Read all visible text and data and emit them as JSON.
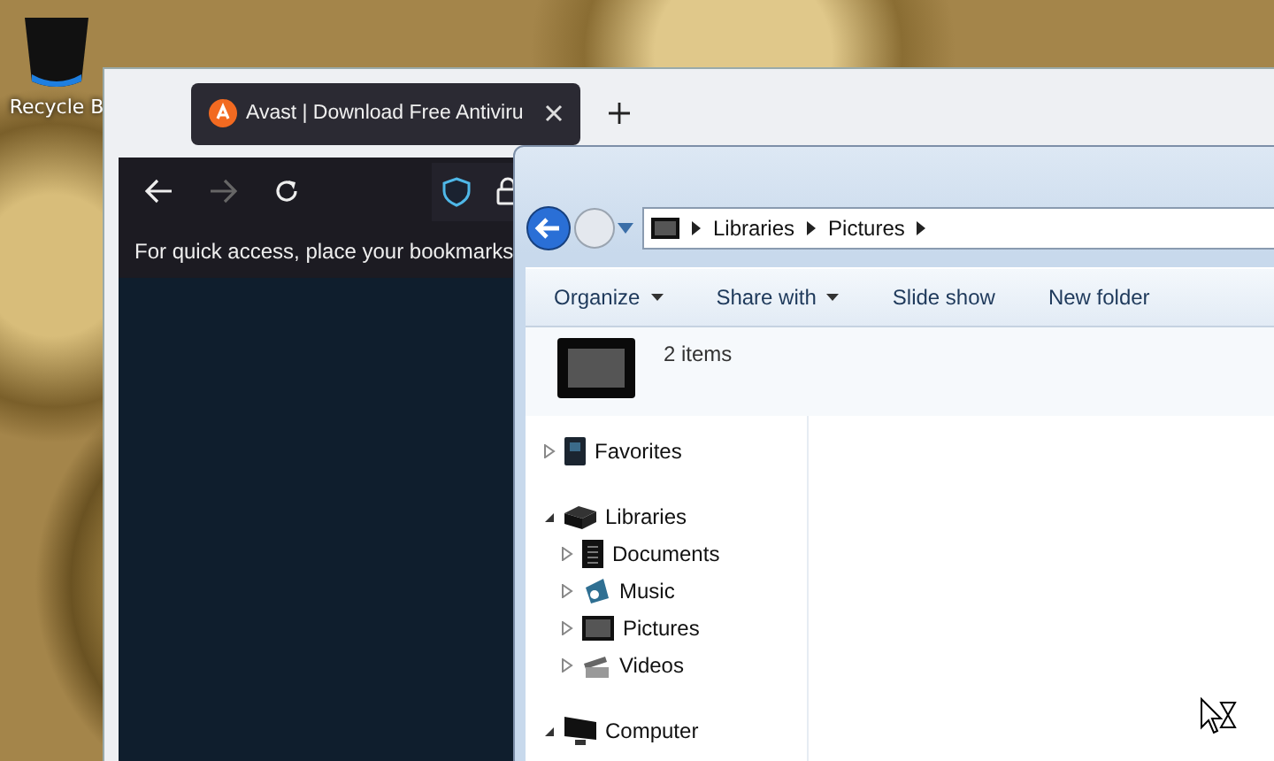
{
  "desktop": {
    "icons": [
      {
        "label": "Recycle B"
      }
    ]
  },
  "browser": {
    "tabs": [
      {
        "title": "Avast | Download Free Antiviru",
        "selected": true
      }
    ],
    "forward_disabled": true,
    "bookmarks_bar": {
      "text": "For quick access, place your bookmarks"
    }
  },
  "explorer": {
    "breadcrumb": [
      "Libraries",
      "Pictures"
    ],
    "toolbar": [
      {
        "label": "Organize",
        "dropdown": true
      },
      {
        "label": "Share with",
        "dropdown": true
      },
      {
        "label": "Slide show",
        "dropdown": false
      },
      {
        "label": "New folder",
        "dropdown": false
      }
    ],
    "details": {
      "count": "2 items"
    },
    "tree": [
      {
        "label": "Favorites",
        "kind": "favorites",
        "expanded": false
      },
      {
        "label": "Libraries",
        "kind": "library",
        "expanded": true,
        "children": [
          {
            "label": "Documents",
            "kind": "documents",
            "expanded": false
          },
          {
            "label": "Music",
            "kind": "music",
            "expanded": false
          },
          {
            "label": "Pictures",
            "kind": "pictures",
            "expanded": false
          },
          {
            "label": "Videos",
            "kind": "videos",
            "expanded": false
          }
        ]
      },
      {
        "label": "Computer",
        "kind": "computer",
        "expanded": true
      }
    ]
  }
}
